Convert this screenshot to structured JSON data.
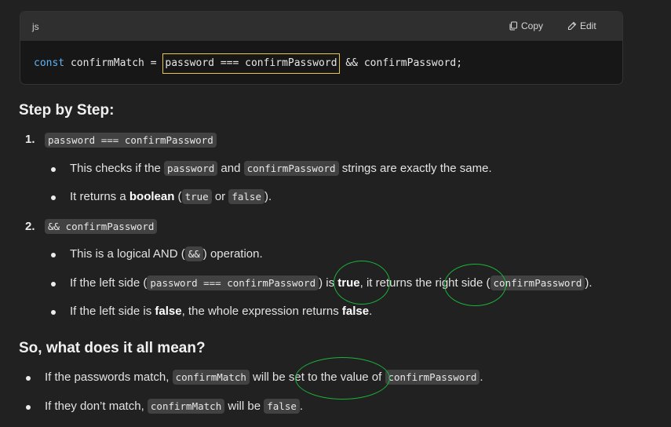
{
  "code_block": {
    "language": "js",
    "copy_label": "Copy",
    "edit_label": "Edit",
    "copy_icon": "copy-icon",
    "edit_icon": "pencil-icon",
    "line": {
      "keyword": "const",
      "pre": " confirmMatch = ",
      "highlighted": "password === confirmPassword",
      "post": " && confirmPassword;"
    },
    "highlight_color": "#e8c549",
    "keyword_color": "#5fb3f5"
  },
  "section1": {
    "heading": "Step by Step:",
    "steps": [
      {
        "number": "1.",
        "code": "password === confirmPassword",
        "bullets": [
          {
            "t1": "This checks if the ",
            "c1": "password",
            "t2": " and ",
            "c2": "confirmPassword",
            "t3": " strings are exactly the same."
          },
          {
            "t1": "It returns a ",
            "b1": "boolean",
            "t2": " (",
            "c1": "true",
            "t3": " or ",
            "c2": "false",
            "t4": ")."
          }
        ]
      },
      {
        "number": "2.",
        "code": "&& confirmPassword",
        "bullets": [
          {
            "t1": "This is a logical AND (",
            "c1": "&&",
            "t2": ") operation."
          },
          {
            "t1": "If the left side (",
            "c1": "password === confirmPassword",
            "t2": ") is ",
            "b1": "true",
            "t3": ", it returns the right side (",
            "c2": "confirmPassword",
            "t4": ")."
          },
          {
            "t1": "If the left side is ",
            "b1": "false",
            "t2": ", the whole expression returns ",
            "b2": "false",
            "t3": "."
          }
        ]
      }
    ]
  },
  "section2": {
    "heading": "So, what does it all mean?",
    "bullets": [
      {
        "t1": "If the passwords match, ",
        "c1": "confirmMatch",
        "t2": " will be set to the value of ",
        "c2": "confirmPassword",
        "t3": "."
      },
      {
        "t1": "If they don’t match, ",
        "c1": "confirmMatch",
        "t2": " will be ",
        "c2": "false",
        "t3": "."
      }
    ]
  },
  "annotation_color": "#19b43a"
}
